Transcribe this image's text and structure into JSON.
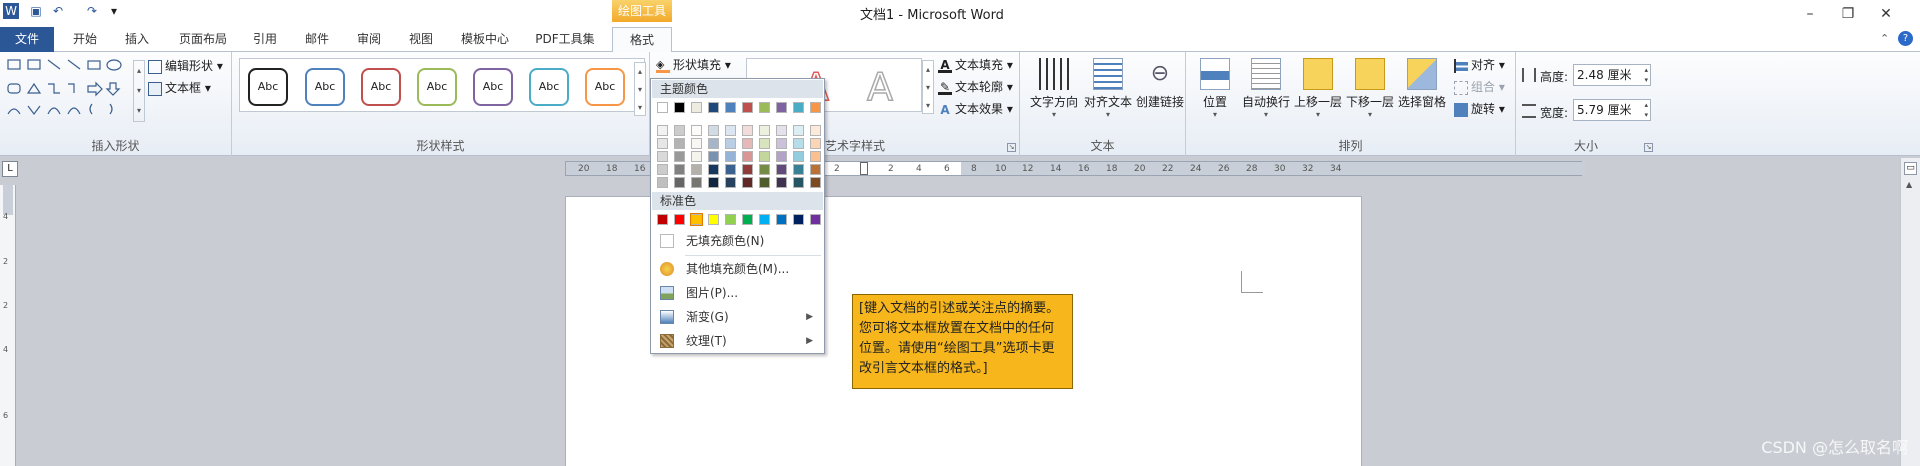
{
  "window": {
    "title": "文档1 - Microsoft Word",
    "contextual_tab_header": "绘图工具"
  },
  "ribbon_tabs": [
    "文件",
    "开始",
    "插入",
    "页面布局",
    "引用",
    "邮件",
    "审阅",
    "视图",
    "模板中心",
    "PDF工具集",
    "格式"
  ],
  "groups": {
    "insert_shape": {
      "label": "插入形状",
      "edit_shape": "编辑形状",
      "text_box": "文本框"
    },
    "shape_styles": {
      "label": "形状样式",
      "style_text": "Abc",
      "shape_fill": "形状填充",
      "border_colors": [
        "#222222",
        "#4f81bd",
        "#c0504d",
        "#9bbb59",
        "#8064a2",
        "#4bacc6",
        "#f79646"
      ]
    },
    "wordart": {
      "label": "艺术字样式",
      "text_fill": "文本填充",
      "text_outline": "文本轮廓",
      "text_effects": "文本效果"
    },
    "text": {
      "label": "文本",
      "direction": "文字方向",
      "align": "对齐文本",
      "link": "创建链接"
    },
    "arrange": {
      "label": "排列",
      "position": "位置",
      "wrap": "自动换行",
      "forward": "上移一层",
      "backward": "下移一层",
      "pane": "选择窗格",
      "align": "对齐",
      "group": "组合",
      "rotate": "旋转"
    },
    "size": {
      "label": "大小",
      "height_label": "高度:",
      "height_value": "2.48 厘米",
      "width_label": "宽度:",
      "width_value": "5.79 厘米"
    }
  },
  "fill_menu": {
    "theme_header": "主题颜色",
    "theme_colors": [
      "#ffffff",
      "#000000",
      "#eeece1",
      "#1f497d",
      "#4f81bd",
      "#c0504d",
      "#9bbb59",
      "#8064a2",
      "#4bacc6",
      "#f79646"
    ],
    "standard_header": "标准色",
    "standard_colors": [
      "#c00000",
      "#ff0000",
      "#ffc000",
      "#ffff00",
      "#92d050",
      "#00b050",
      "#00b0f0",
      "#0070c0",
      "#002060",
      "#7030a0"
    ],
    "items": [
      "无填充颜色(N)",
      "其他填充颜色(M)...",
      "图片(P)...",
      "渐变(G)",
      "纹理(T)"
    ]
  },
  "ruler_numbers": [
    "20",
    "18",
    "16",
    "2",
    "2",
    "4",
    "6",
    "8",
    "10",
    "12",
    "14",
    "16",
    "18",
    "20",
    "22",
    "24",
    "26",
    "28",
    "30",
    "32",
    "34"
  ],
  "vruler_numbers": [
    "4",
    "2",
    "2",
    "4",
    "6"
  ],
  "callout_text": "[键入文档的引述或关注点的摘要。您可将文本框放置在文档中的任何位置。请使用“绘图工具”选项卡更改引言文本框的格式。]",
  "watermark": "CSDN @怎么取名啊"
}
